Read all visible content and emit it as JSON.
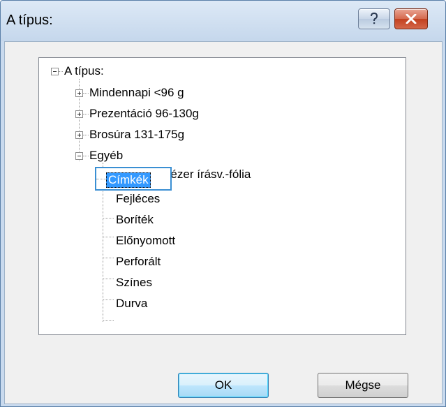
{
  "window": {
    "title": "A típus:",
    "help_label": "?",
    "close_label": "x"
  },
  "tree": {
    "root": {
      "label": "A típus:",
      "expanded": true,
      "children": [
        {
          "label": "Mindennapi <96 g",
          "expanded": false
        },
        {
          "label": "Prezentáció 96-130g",
          "expanded": false
        },
        {
          "label": "Brosúra 131-175g",
          "expanded": false
        },
        {
          "label": "Egyéb",
          "expanded": true,
          "children": [
            {
              "label": "Egyszínű lézer írásv.-fólia"
            },
            {
              "label": "Címkék",
              "selected": true
            },
            {
              "label": "Fejléces"
            },
            {
              "label": "Boríték"
            },
            {
              "label": "Előnyomott"
            },
            {
              "label": "Perforált"
            },
            {
              "label": "Színes"
            },
            {
              "label": "Durva"
            }
          ]
        }
      ]
    }
  },
  "buttons": {
    "ok": "OK",
    "cancel": "Mégse"
  }
}
